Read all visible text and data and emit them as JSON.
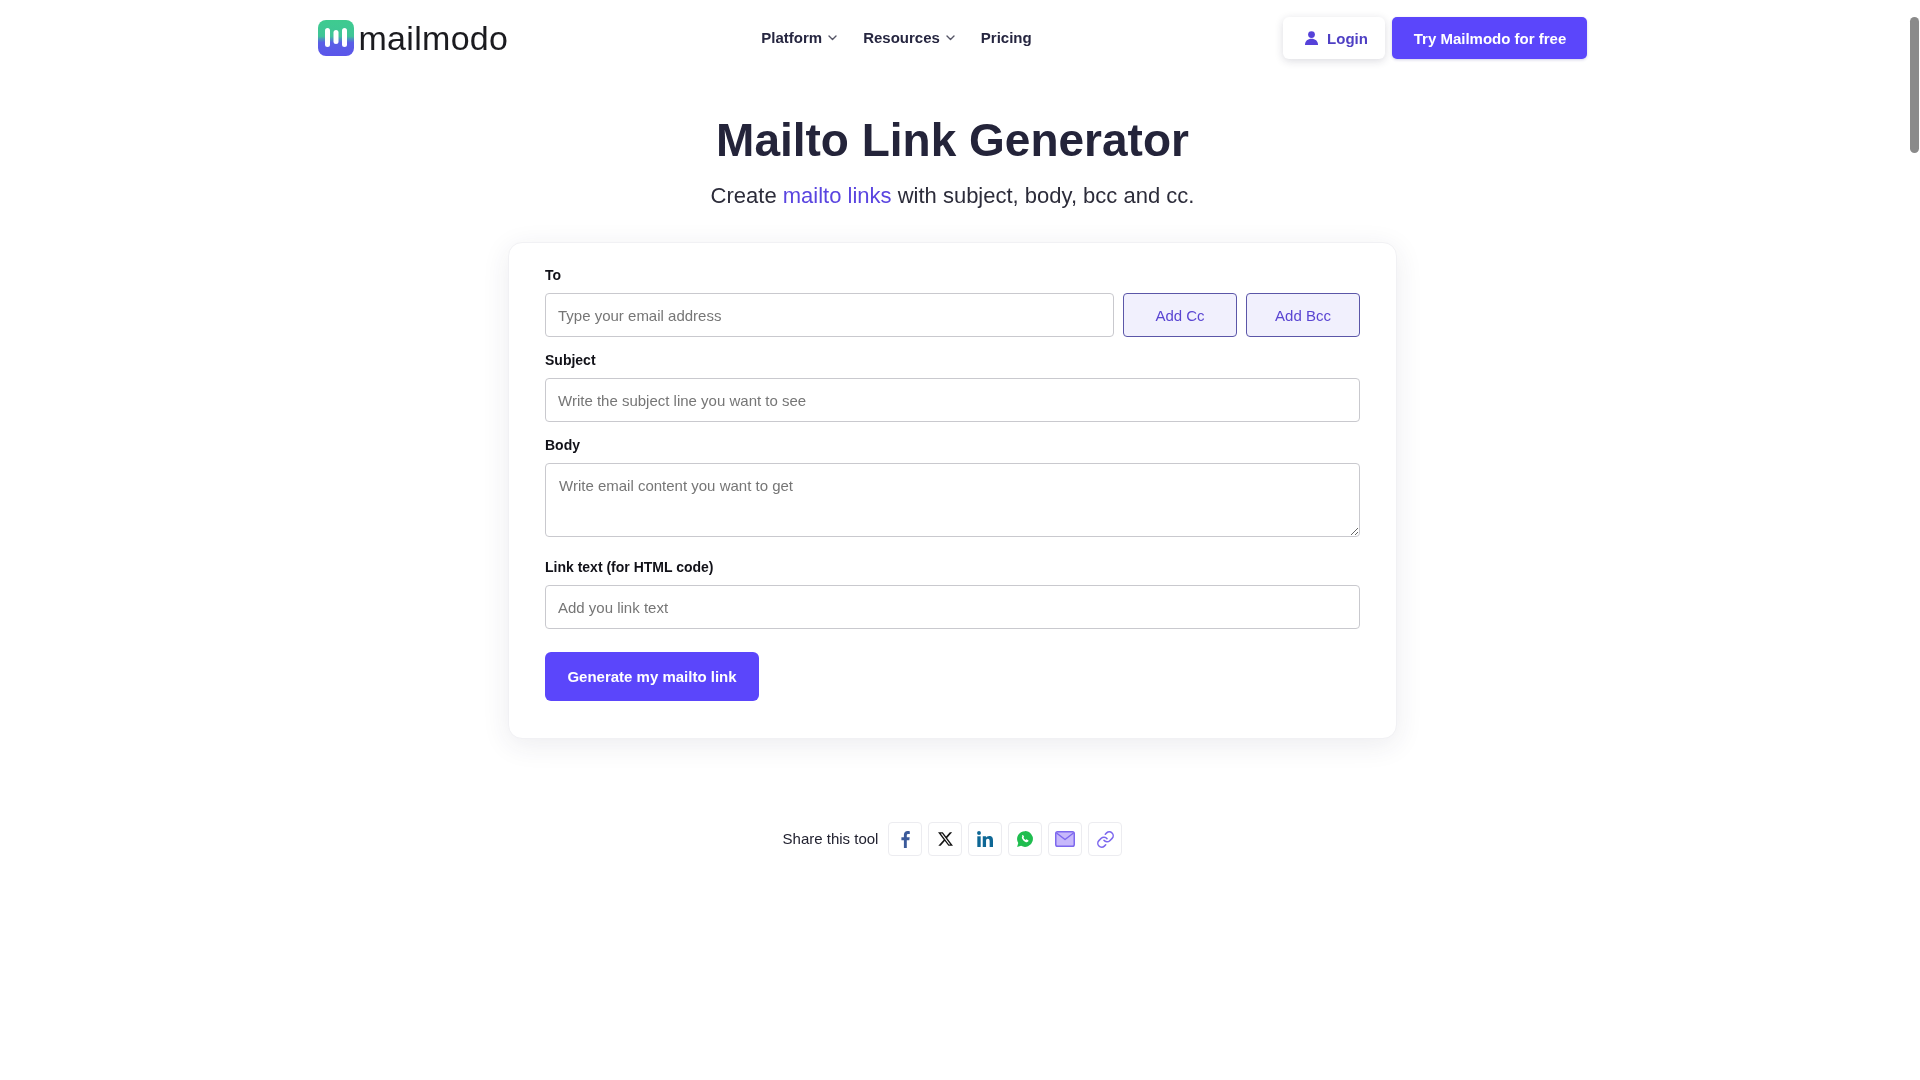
{
  "header": {
    "logo_text": "mailmodo",
    "nav": [
      {
        "label": "Platform",
        "has_menu": true
      },
      {
        "label": "Resources",
        "has_menu": true
      },
      {
        "label": "Pricing",
        "has_menu": false
      }
    ],
    "login_button": "Login",
    "cta_button": "Try Mailmodo for free"
  },
  "hero": {
    "title": "Mailto Link Generator",
    "subtitle_before": "Create",
    "subtitle_link": "mailto links",
    "subtitle_after": "with subject, body, bcc and cc."
  },
  "form": {
    "fields": [
      {
        "kind": "input",
        "label": "To",
        "placeholder": "Type your email address",
        "buttons": [
          "Add Cc",
          "Add Bcc"
        ]
      },
      {
        "kind": "input",
        "label": "Subject",
        "placeholder": "Write the subject line you want to see"
      },
      {
        "kind": "textarea",
        "label": "Body",
        "placeholder": "Write email content you want to get"
      },
      {
        "kind": "input",
        "label": "Link text (for HTML code)",
        "placeholder": "Add you link text"
      }
    ],
    "submit_button": "Generate my mailto link"
  },
  "share": {
    "label": "Share this tool",
    "buttons": [
      {
        "kind": "facebook"
      },
      {
        "kind": "x"
      },
      {
        "kind": "linkedin"
      },
      {
        "kind": "whatsapp"
      },
      {
        "kind": "email"
      },
      {
        "kind": "link"
      }
    ]
  }
}
